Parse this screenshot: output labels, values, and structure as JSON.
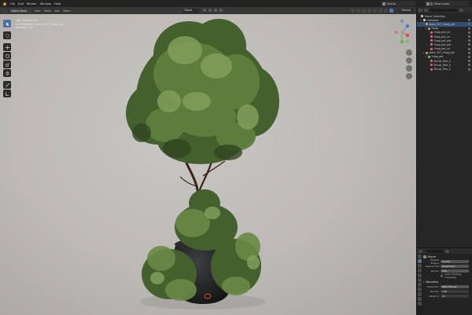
{
  "topbar": {
    "menus": [
      "File",
      "Edit",
      "Render",
      "Window",
      "Help"
    ],
    "scene": "Scene",
    "view_layer": "View Layer"
  },
  "viewport": {
    "mode": "Object Mode",
    "menus": [
      "View",
      "Select",
      "Add",
      "Object"
    ],
    "orientation": "Global",
    "options": "Options",
    "overlay_lines": [
      "User Perspective",
      "(1) Collection | plant_007_Osag_pot",
      "Samples: 1/1"
    ]
  },
  "outliner": {
    "rows": [
      {
        "label": "Scene Collection",
        "indent": 0,
        "tri": "",
        "color": "#c9c9c9"
      },
      {
        "label": "Collection",
        "indent": 1,
        "tri": "▾",
        "color": "#c9c9c9"
      },
      {
        "label": "plant_007_Osag_pot",
        "indent": 2,
        "tri": "▾",
        "color": "#e0963a"
      },
      {
        "label": "Osag",
        "indent": 3,
        "tri": "▾",
        "color": "#7fb86a"
      },
      {
        "label": "Osag_pot_co",
        "indent": 4,
        "tri": "",
        "color": "#d06a6a"
      },
      {
        "label": "Osag_pot_co",
        "indent": 4,
        "tri": "",
        "color": "#d06a6a"
      },
      {
        "label": "Osag_pot_pot",
        "indent": 4,
        "tri": "",
        "color": "#d06a6a"
      },
      {
        "label": "Osag_pot_pot",
        "indent": 4,
        "tri": "",
        "color": "#d06a6a"
      },
      {
        "label": "Osag_pot_co",
        "indent": 4,
        "tri": "",
        "color": "#d06a6a"
      },
      {
        "label": "plant_007_Osag_pot",
        "indent": 2,
        "tri": "▾",
        "color": "#e0963a"
      },
      {
        "label": "Osag_pot",
        "indent": 3,
        "tri": "▾",
        "color": "#7fb86a"
      },
      {
        "label": "Shrub_Tree_S",
        "indent": 4,
        "tri": "",
        "color": "#d06a6a"
      },
      {
        "label": "Shrub_Tree_S",
        "indent": 4,
        "tri": "",
        "color": "#d06a6a"
      },
      {
        "label": "Shrub_Tree_S",
        "indent": 4,
        "tri": "",
        "color": "#d06a6a"
      }
    ]
  },
  "properties": {
    "panel_title": "Scene",
    "render_engine_label": "Render Engine",
    "render_engine": "Cycles",
    "feature_set_label": "Feature Set",
    "feature_set": "Supported",
    "device_label": "Device",
    "device": "CPU",
    "osl_label": "Open Shading Language",
    "sampling_label": "Sampling",
    "integrator_label": "Integrator",
    "integrator": "Path Tracing",
    "render_label": "Render",
    "render_value": "128",
    "viewport_label": "Viewport",
    "viewport_value": "32"
  },
  "colors": {
    "accent": "#4b72a8",
    "selection": "#334d73",
    "background": "#1d1d1d"
  }
}
